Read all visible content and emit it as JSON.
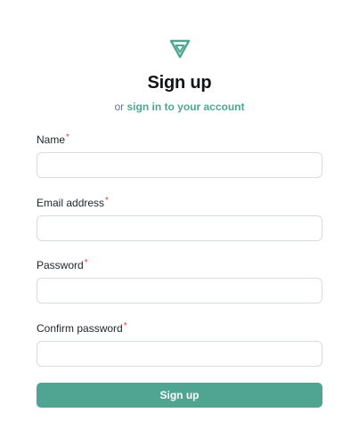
{
  "brand": {
    "logo_icon": "triangle-logo-icon",
    "accent_color": "#4fa592"
  },
  "header": {
    "title": "Sign up",
    "subtitle_prefix": "or",
    "subtitle_link": "sign in to your account"
  },
  "form": {
    "required_marker": "*",
    "fields": [
      {
        "label": "Name",
        "value": "",
        "placeholder": ""
      },
      {
        "label": "Email address",
        "value": "",
        "placeholder": ""
      },
      {
        "label": "Password",
        "value": "",
        "placeholder": ""
      },
      {
        "label": "Confirm password",
        "value": "",
        "placeholder": ""
      }
    ],
    "submit_label": "Sign up"
  }
}
